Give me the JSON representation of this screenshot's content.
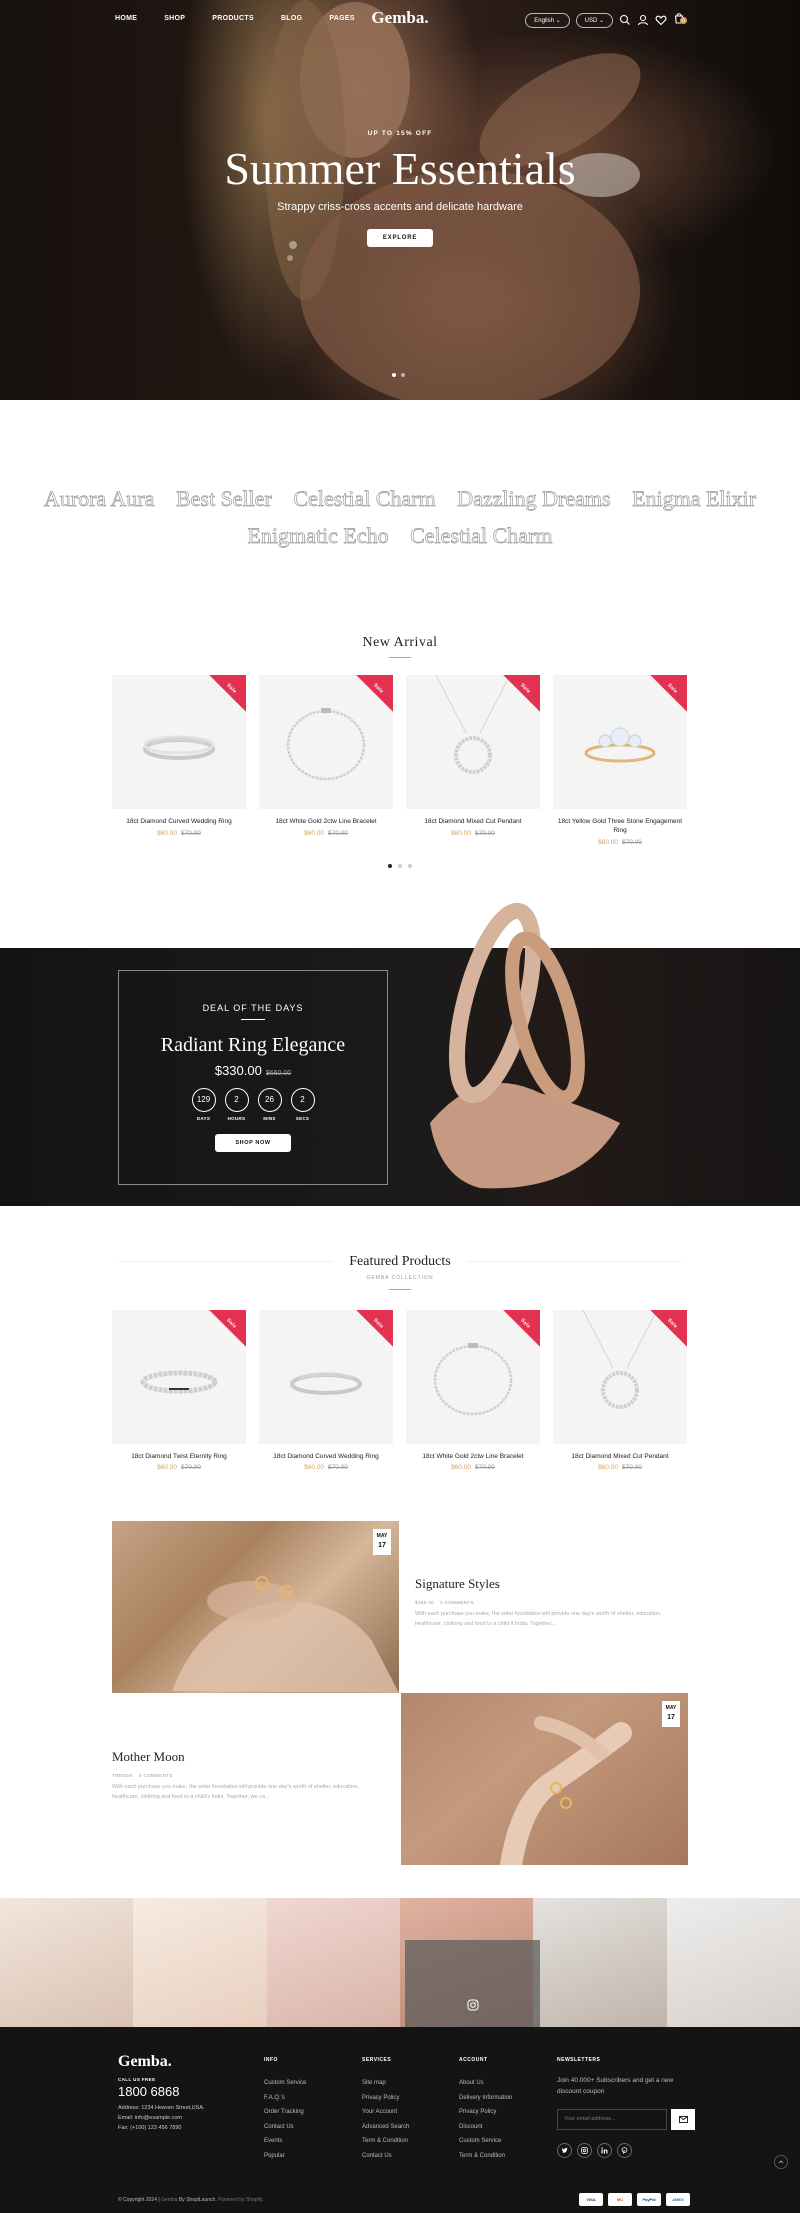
{
  "nav": {
    "links": [
      "HOME",
      "SHOP",
      "PRODUCTS",
      "BLOG",
      "PAGES"
    ],
    "logo": "Gemba.",
    "language": "English",
    "currency": "USD",
    "icons": [
      "search-icon",
      "user-icon",
      "heart-icon",
      "cart-icon"
    ],
    "cart_count": "0"
  },
  "hero": {
    "kicker": "UP TO 15% OFF",
    "title": "Summer Essentials",
    "subtitle": "Strappy criss-cross accents and delicate hardware",
    "button": "EXPLORE",
    "slide_count": 2,
    "active_slide": 1
  },
  "brands": {
    "row1": [
      "Aurora Aura",
      "Best Seller",
      "Celestial Charm",
      "Dazzling Dreams",
      "Enigma Elixir"
    ],
    "row2": [
      "Enigmatic Echo",
      "Celestial Charm"
    ]
  },
  "new_arrival": {
    "title": "New Arrival",
    "products": [
      {
        "name": "18ct Diamond Curved Wedding Ring",
        "price": "$60.00",
        "old_price": "$70.00",
        "badge": "Sale"
      },
      {
        "name": "18ct White Gold 2ctw Line Bracelet",
        "price": "$60.00",
        "old_price": "$70.00",
        "badge": "Sale"
      },
      {
        "name": "18ct Diamond Mixed Cut Pendant",
        "price": "$60.00",
        "old_price": "$70.00",
        "badge": "Sale"
      },
      {
        "name": "18ct Yellow Gold Three Stone Engagement Ring",
        "price": "$60.00",
        "old_price": "$70.00",
        "badge": "Sale"
      }
    ],
    "page_count": 3,
    "active_page": 1
  },
  "deal": {
    "kicker": "DEAL OF THE DAYS",
    "title": "Radiant Ring Elegance",
    "price": "$330.00",
    "old_price": "$660.00",
    "countdown": [
      {
        "value": "129",
        "label": "DAYS"
      },
      {
        "value": "2",
        "label": "HOURS"
      },
      {
        "value": "26",
        "label": "MINS"
      },
      {
        "value": "2",
        "label": "SECS"
      }
    ],
    "button": "SHOP NOW"
  },
  "featured": {
    "title": "Featured Products",
    "subtitle": "GEMBA COLLECTION",
    "products": [
      {
        "name": "18ct Diamond Twist Eternity Ring",
        "price": "$60.00",
        "old_price": "$70.00",
        "badge": "Sale"
      },
      {
        "name": "18ct Diamond Curved Wedding Ring",
        "price": "$60.00",
        "old_price": "$70.00",
        "badge": "Sale"
      },
      {
        "name": "18ct White Gold 2ctw Line Bracelet",
        "price": "$60.00",
        "old_price": "$70.00",
        "badge": "Sale"
      },
      {
        "name": "18ct Diamond Mixed Cut Pendant",
        "price": "$60.00",
        "old_price": "$70.00",
        "badge": "Sale"
      }
    ]
  },
  "blog": {
    "posts": [
      {
        "title": "Signature Styles",
        "month": "MAY",
        "day": "17",
        "meta1": "$199.00",
        "meta2": "0 COMMENTS",
        "excerpt": "With each purchase you make, the setar foundation will provide one day's worth of shelter, education, healthcare, clothing and food to a child it India. Together..."
      },
      {
        "title": "Mother Moon",
        "month": "MAY",
        "day": "17",
        "meta1": "TRENDS",
        "meta2": "0 COMMENTS",
        "excerpt": "With each purchase you make, the setar foundation will provide one day's worth of shelter, education, healthcare, clothing and food to a child's India. Together, we ca..."
      }
    ]
  },
  "footer": {
    "logo": "Gemba.",
    "call_label": "CALL US FREE",
    "phone": "1800 6868",
    "address": "Address: 1234 Heaven Street,USA.",
    "email": "Email: info@example.com",
    "fax": "Fax: (+100) 123 456 7890",
    "columns": [
      {
        "title": "INFO",
        "items": [
          "Custom Service",
          "F.A.Q.'s",
          "Order Tracking",
          "Contact Us",
          "Events",
          "Popular"
        ]
      },
      {
        "title": "SERVICES",
        "items": [
          "Site map",
          "Privacy Policy",
          "Your Account",
          "Advanced Search",
          "Term & Condition",
          "Contact Us"
        ]
      },
      {
        "title": "ACCOUNT",
        "items": [
          "About Us",
          "Delivery Information",
          "Privacy Policy",
          "Discount",
          "Custom Service",
          "Term & Condition"
        ]
      }
    ],
    "newsletter_title": "NEWSLETTERS",
    "newsletter_text": "Join 40.000+ Subscribers and get a new discount coupon",
    "email_placeholder": "Your email address...",
    "socials": [
      "twitter-icon",
      "instagram-icon",
      "linkedin-icon",
      "pinterest-icon"
    ],
    "copyright_main": "© Copyright 2024 |",
    "copyright_brand": "Gemba",
    "copyright_by": "By ShopiLaunch.",
    "copyright_powered": "Powered by Shopify.",
    "payments": [
      "VISA",
      "MC",
      "PayPal",
      "AMEX"
    ]
  }
}
